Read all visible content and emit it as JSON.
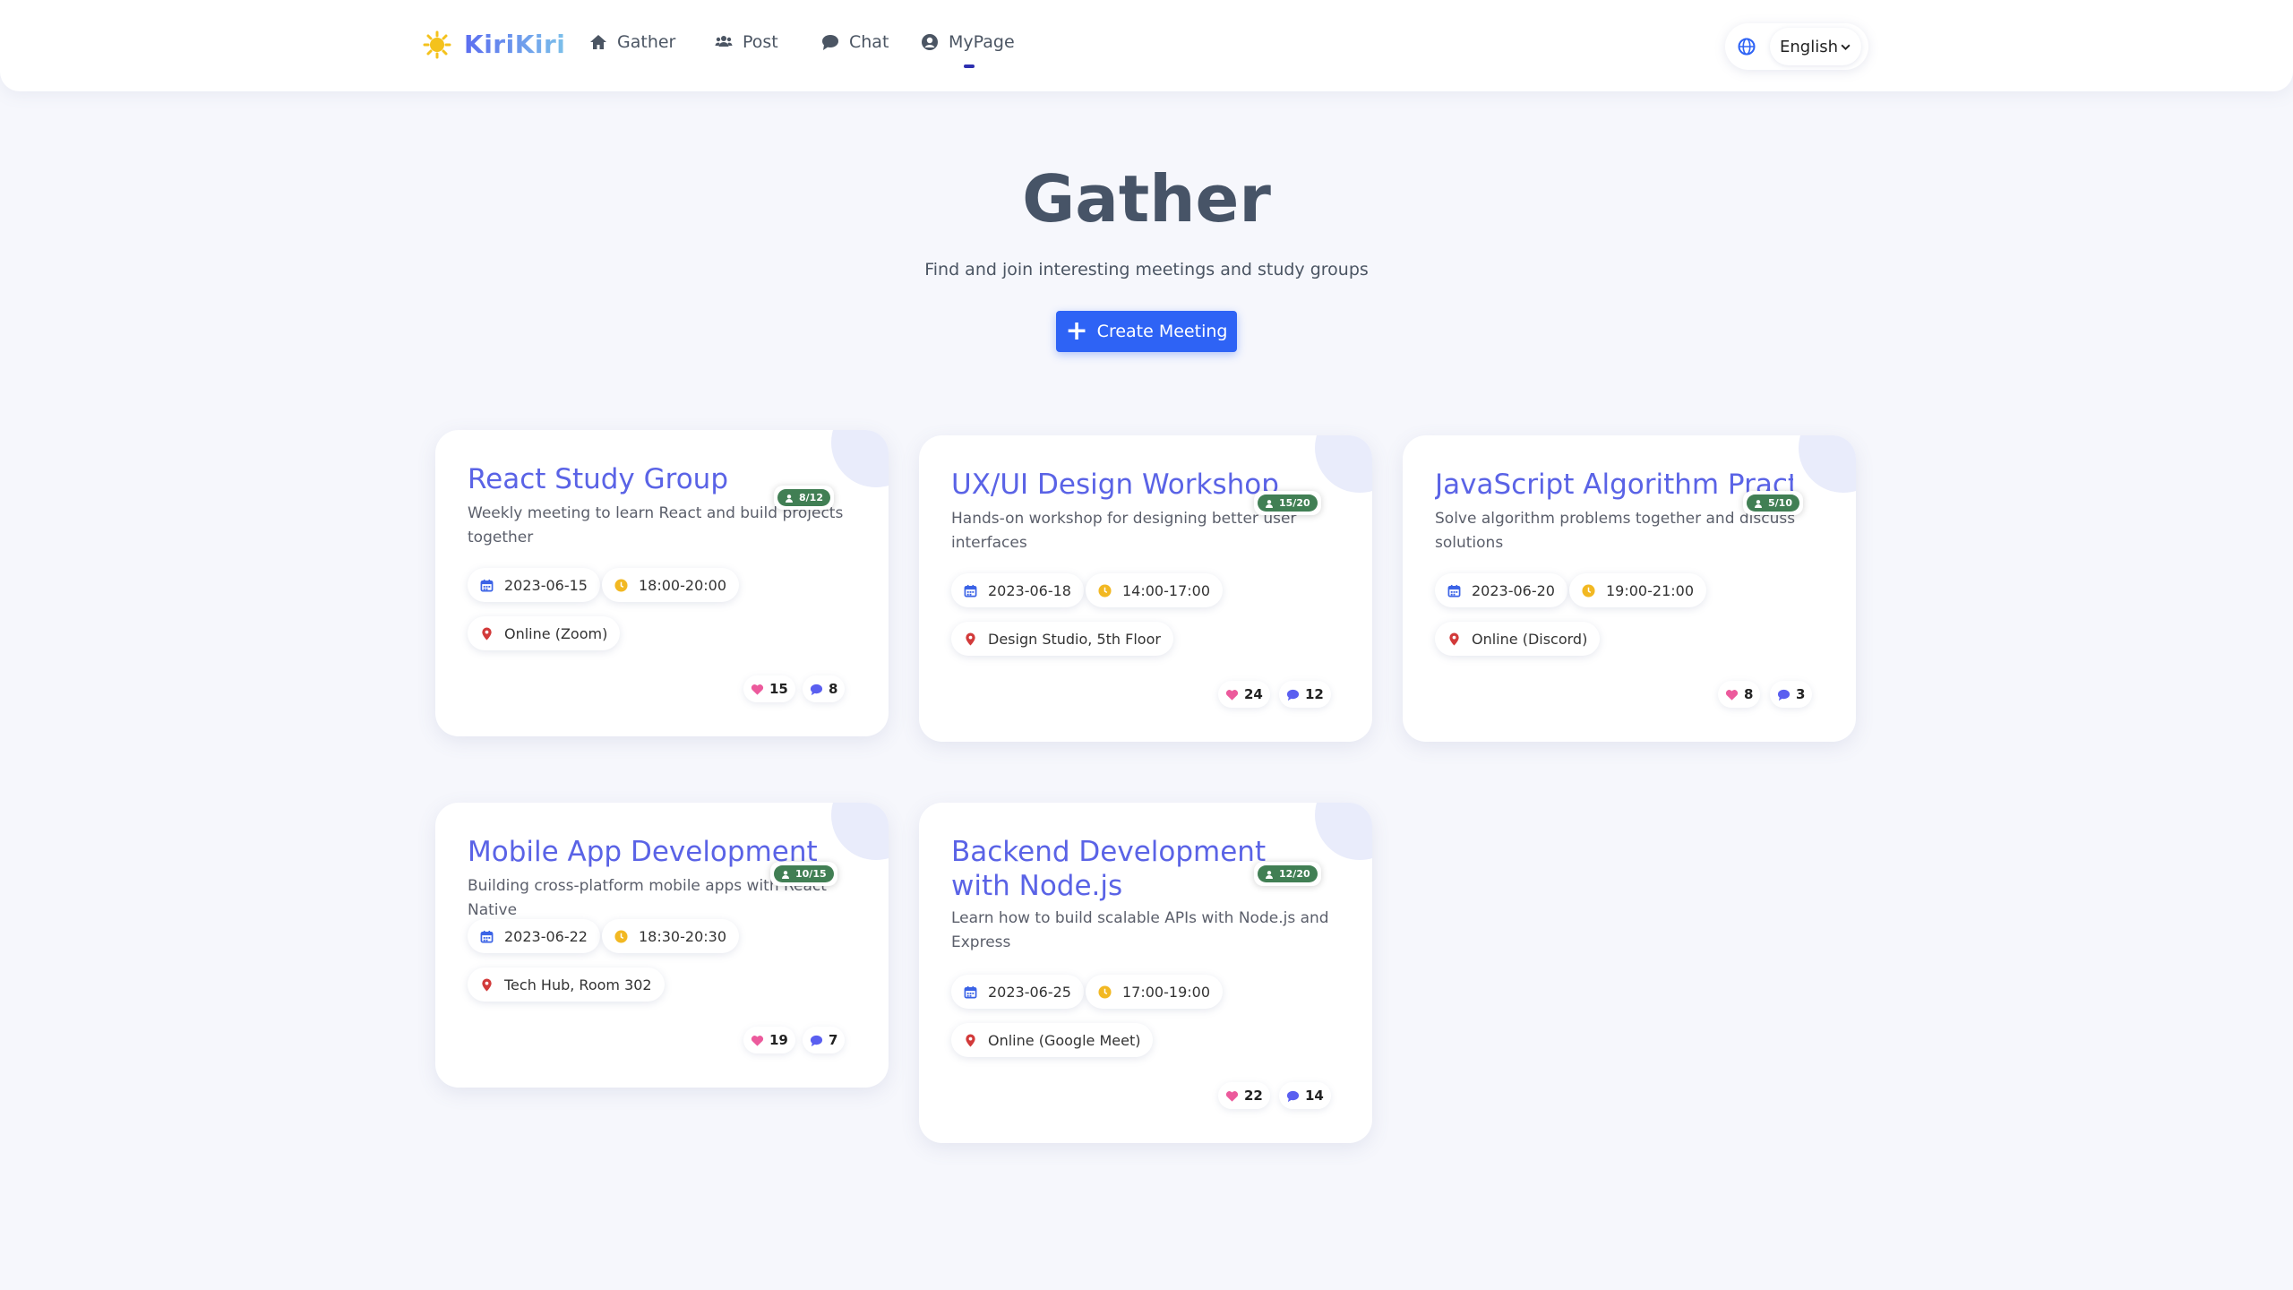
{
  "brand": {
    "name": "KiriKiri"
  },
  "nav": {
    "items": [
      {
        "label": "Gather",
        "icon": "home-icon"
      },
      {
        "label": "Post",
        "icon": "users-icon"
      },
      {
        "label": "Chat",
        "icon": "chat-bubble-icon"
      },
      {
        "label": "MyPage",
        "icon": "user-circle-icon",
        "active": true
      }
    ],
    "language": "English"
  },
  "header": {
    "title": "Gather",
    "subtitle": "Find and join interesting meetings and study groups",
    "create_button": "Create Meeting"
  },
  "colors": {
    "accent": "#2e63f5",
    "title": "#5a63e6",
    "badge": "#417f54",
    "like": "#ec5a9c",
    "comment": "#5a5ff0"
  },
  "meetings": [
    {
      "title": "React Study Group",
      "description": "Weekly meeting to learn React and build projects together",
      "participants": "8/12",
      "date": "2023-06-15",
      "time": "18:00-20:00",
      "location": "Online (Zoom)",
      "likes": "15",
      "comments": "8"
    },
    {
      "title": "UX/UI Design Workshop",
      "description": "Hands-on workshop for designing better user interfaces",
      "participants": "15/20",
      "date": "2023-06-18",
      "time": "14:00-17:00",
      "location": "Design Studio, 5th Floor",
      "likes": "24",
      "comments": "12"
    },
    {
      "title": "JavaScript Algorithm Practice",
      "description": "Solve algorithm problems together and discuss solutions",
      "participants": "5/10",
      "date": "2023-06-20",
      "time": "19:00-21:00",
      "location": "Online (Discord)",
      "likes": "8",
      "comments": "3"
    },
    {
      "title": "Mobile App Development",
      "description": "Building cross-platform mobile apps with React Native",
      "participants": "10/15",
      "date": "2023-06-22",
      "time": "18:30-20:30",
      "location": "Tech Hub, Room 302",
      "likes": "19",
      "comments": "7"
    },
    {
      "title": "Backend Development with Node.js",
      "description": "Learn how to build scalable APIs with Node.js and Express",
      "participants": "12/20",
      "date": "2023-06-25",
      "time": "17:00-19:00",
      "location": "Online (Google Meet)",
      "likes": "22",
      "comments": "14"
    }
  ]
}
